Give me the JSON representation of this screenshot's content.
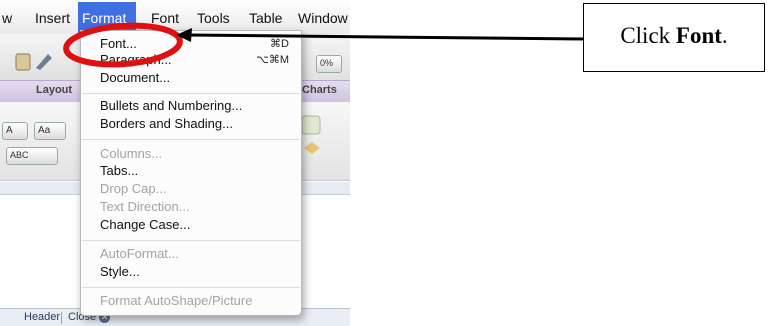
{
  "menubar": {
    "items": [
      "w",
      "Insert",
      "Format",
      "Font",
      "Tools",
      "Table",
      "Window"
    ],
    "active_item": "Format"
  },
  "ribbon": {
    "tabs": [
      "Layout",
      "Charts"
    ],
    "zoom_value": "0%",
    "font_size_control": "A",
    "grow_font_control": "Aa",
    "highlight_control": "ABC"
  },
  "format_menu": {
    "items": [
      {
        "label": "Font...",
        "shortcut": "⌘D",
        "enabled": true
      },
      {
        "label": "Paragraph...",
        "shortcut": "⌥⌘M",
        "enabled": true
      },
      {
        "label": "Document...",
        "shortcut": "",
        "enabled": true
      },
      {
        "label": "Bullets and Numbering...",
        "shortcut": "",
        "enabled": true
      },
      {
        "label": "Borders and Shading...",
        "shortcut": "",
        "enabled": true
      },
      {
        "label": "Columns...",
        "shortcut": "",
        "enabled": false
      },
      {
        "label": "Tabs...",
        "shortcut": "",
        "enabled": true
      },
      {
        "label": "Drop Cap...",
        "shortcut": "",
        "enabled": false
      },
      {
        "label": "Text Direction...",
        "shortcut": "",
        "enabled": false
      },
      {
        "label": "Change Case...",
        "shortcut": "",
        "enabled": true
      },
      {
        "label": "AutoFormat...",
        "shortcut": "",
        "enabled": false
      },
      {
        "label": "Style...",
        "shortcut": "",
        "enabled": true
      },
      {
        "label": "Format AutoShape/Picture",
        "shortcut": "",
        "enabled": false
      }
    ]
  },
  "statusbar": {
    "header_label": "Header",
    "close_label": "Close"
  },
  "annotation": {
    "text_prefix": "Click ",
    "text_bold": "Font",
    "text_suffix": ".",
    "highlight_color": "#e01010",
    "arrow_color": "#000000"
  },
  "colors": {
    "menu_highlight": "#3f6fe0",
    "ribbon_tab_band": "#d6cbe6"
  }
}
